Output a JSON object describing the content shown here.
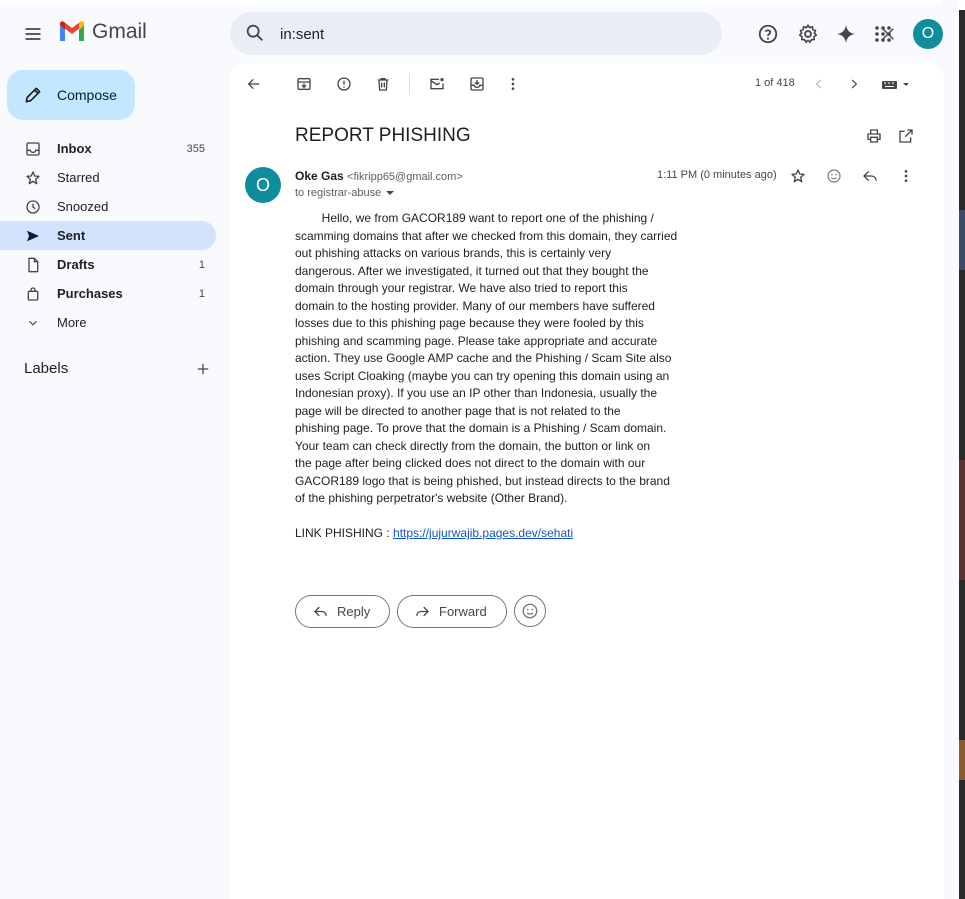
{
  "app": {
    "name": "Gmail"
  },
  "search": {
    "query": "in:sent"
  },
  "compose": {
    "label": "Compose"
  },
  "nav": [
    {
      "label": "Inbox",
      "count": "355",
      "icon": "inbox-icon"
    },
    {
      "label": "Starred",
      "count": "",
      "icon": "star-icon"
    },
    {
      "label": "Snoozed",
      "count": "",
      "icon": "clock-icon"
    },
    {
      "label": "Sent",
      "count": "",
      "icon": "send-icon"
    },
    {
      "label": "Drafts",
      "count": "1",
      "icon": "draft-icon"
    },
    {
      "label": "Purchases",
      "count": "1",
      "icon": "shopping-bag-icon"
    },
    {
      "label": "More",
      "count": "",
      "icon": "chevron-down-icon"
    }
  ],
  "labels": {
    "title": "Labels"
  },
  "user": {
    "initial": "O",
    "avatar_color": "#0f8d9c"
  },
  "toolbar": {
    "pager": "1 of 418"
  },
  "email": {
    "subject": "REPORT PHISHING",
    "sender_name": "Oke Gas",
    "sender_email": "<fikripp65@gmail.com>",
    "sender_initial": "O",
    "to": "to registrar-abuse",
    "time": "1:11 PM (0 minutes ago)",
    "body_lines": [
      "        Hello, we from GACOR189 want to report one of the phishing /",
      "scamming domains that after we checked from this domain, they carried",
      "out phishing attacks on various brands, this is certainly very",
      "dangerous. After we investigated, it turned out that they bought the",
      "domain through your registrar. We have also tried to report this",
      "domain to the hosting provider. Many of our members have suffered",
      "losses due to this phishing page because they were fooled by this",
      "phishing and scamming page. Please take appropriate and accurate",
      "action. They use Google AMP cache and the Phishing / Scam Site also",
      "uses Script Cloaking (maybe you can try opening this domain using an",
      "Indonesian proxy). If you use an IP other than Indonesia, usually the",
      "page will be directed to another page that is not related to the",
      "phishing page. To prove that the domain is a Phishing / Scam domain.",
      "Your team can check directly from the domain, the button or link on",
      "the page after being clicked does not direct to the domain with our",
      "GACOR189 logo that is being phished, but instead directs to the brand",
      "of the phishing perpetrator's website (Other Brand)."
    ],
    "link_label": "LINK PHISHING : ",
    "link_url": "https://jujurwajib.pages.dev/sehati"
  },
  "actions": {
    "reply": "Reply",
    "forward": "Forward"
  }
}
